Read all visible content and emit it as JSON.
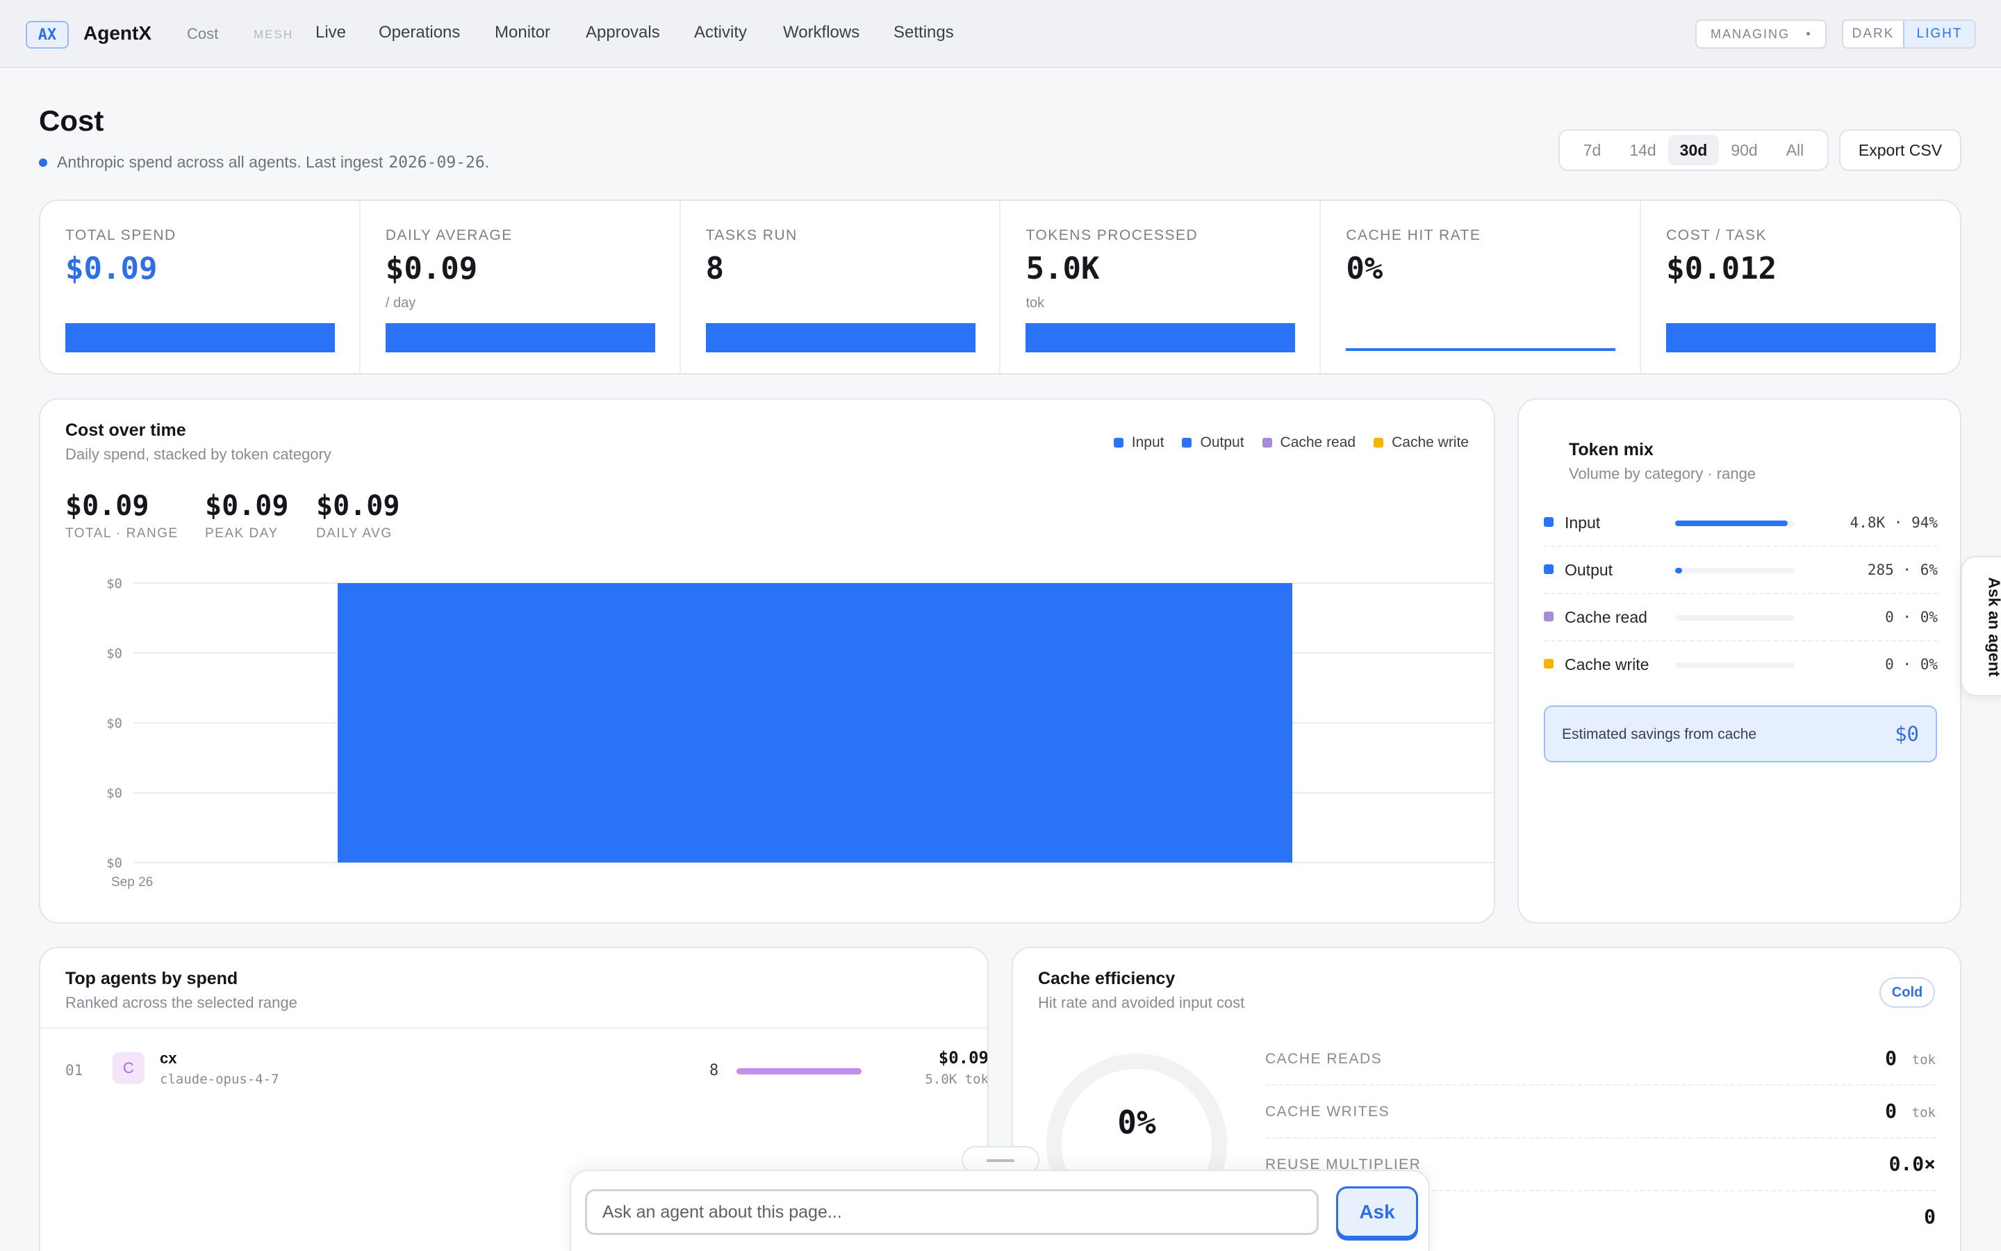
{
  "nav": {
    "logo": "AX",
    "brand": "AgentX",
    "crumb": "Cost",
    "mesh": "MESH",
    "items": [
      "Live",
      "Operations",
      "Monitor",
      "Approvals",
      "Activity",
      "Workflows",
      "Settings"
    ],
    "managing": "MANAGING",
    "theme_dark": "DARK",
    "theme_light": "LIGHT"
  },
  "page": {
    "title": "Cost",
    "subtitle": "Anthropic spend across all agents. Last ingest",
    "ingest_date": "2026-09-26",
    "ingest_suffix": ".",
    "ranges": [
      "7d",
      "14d",
      "30d",
      "90d",
      "All"
    ],
    "active_range": "30d",
    "export_label": "Export CSV"
  },
  "kpis": [
    {
      "label": "TOTAL SPEND",
      "value": "$0.09",
      "unit": "",
      "fill": 1.0
    },
    {
      "label": "DAILY AVERAGE",
      "value": "$0.09",
      "unit": "/ day",
      "fill": 1.0
    },
    {
      "label": "TASKS RUN",
      "value": "8",
      "unit": "",
      "fill": 1.0
    },
    {
      "label": "TOKENS PROCESSED",
      "value": "5.0K",
      "unit": "tok",
      "fill": 1.0
    },
    {
      "label": "CACHE HIT RATE",
      "value": "0%",
      "unit": "",
      "fill": 0.0
    },
    {
      "label": "COST / TASK",
      "value": "$0.012",
      "unit": "",
      "fill": 1.0
    }
  ],
  "cost_over_time": {
    "title": "Cost over time",
    "subtitle": "Daily spend, stacked by token category",
    "legend": [
      {
        "name": "Input",
        "color": "#2a73f6"
      },
      {
        "name": "Output",
        "color": "#2a73f6"
      },
      {
        "name": "Cache read",
        "color": "#a78bdb"
      },
      {
        "name": "Cache write",
        "color": "#f5b400"
      }
    ],
    "stats": [
      {
        "value": "$0.09",
        "label": "TOTAL · RANGE"
      },
      {
        "value": "$0.09",
        "label": "PEAK DAY"
      },
      {
        "value": "$0.09",
        "label": "DAILY AVG"
      }
    ]
  },
  "chart_data": {
    "type": "bar",
    "categories": [
      "Sep 26"
    ],
    "series": [
      {
        "name": "Input",
        "values": [
          0.09
        ]
      },
      {
        "name": "Output",
        "values": [
          0
        ]
      },
      {
        "name": "Cache read",
        "values": [
          0
        ]
      },
      {
        "name": "Cache write",
        "values": [
          0
        ]
      }
    ],
    "y_tick_labels": [
      "$0",
      "$0",
      "$0",
      "$0",
      "$0"
    ],
    "ylim": [
      0,
      0.09
    ],
    "grid": true,
    "legend": "top-right"
  },
  "token_mix": {
    "title": "Token mix",
    "subtitle": "Volume by category · range",
    "rows": [
      {
        "name": "Input",
        "count": "4.8K",
        "pct": "94%",
        "share": 0.94,
        "color": "#2a73f6"
      },
      {
        "name": "Output",
        "count": "285",
        "pct": "6%",
        "share": 0.06,
        "color": "#2a73f6"
      },
      {
        "name": "Cache read",
        "count": "0",
        "pct": "0%",
        "share": 0,
        "color": "#a78bdb"
      },
      {
        "name": "Cache write",
        "count": "0",
        "pct": "0%",
        "share": 0,
        "color": "#f5b400"
      }
    ],
    "savings_label": "Estimated savings from cache",
    "savings_value": "$0"
  },
  "ask_tab": "Ask an agent",
  "top_agents": {
    "title": "Top agents by spend",
    "subtitle": "Ranked across the selected range",
    "rows": [
      {
        "rank": "01",
        "avatar": "C",
        "name": "cx",
        "model": "claude-opus-4-7",
        "tasks": "8",
        "cost": "$0.09",
        "tokens": "5.0K tok",
        "share": 1.0
      }
    ]
  },
  "cache_efficiency": {
    "title": "Cache efficiency",
    "subtitle": "Hit rate and avoided input cost",
    "badge": "Cold",
    "hit_rate": "0%",
    "rows": [
      {
        "label": "CACHE READS",
        "value": "0",
        "unit": "tok"
      },
      {
        "label": "CACHE WRITES",
        "value": "0",
        "unit": "tok"
      },
      {
        "label": "REUSE MULTIPLIER",
        "value": "0.0×",
        "unit": ""
      },
      {
        "label": "",
        "value": "0",
        "unit": ""
      }
    ]
  },
  "ask_bar": {
    "placeholder": "Ask an agent about this page...",
    "button": "Ask"
  }
}
